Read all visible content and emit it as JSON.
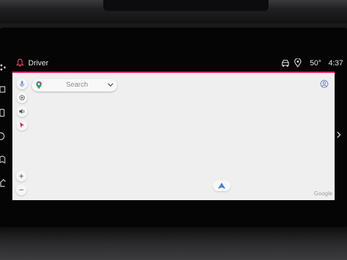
{
  "status_bar": {
    "profile_label": "Driver",
    "temperature": "50°",
    "time": "4:37"
  },
  "map": {
    "search_placeholder": "Search",
    "zoom_in_label": "+",
    "zoom_out_label": "−",
    "attribution": "Google"
  },
  "colors": {
    "accent": "#d8245a",
    "map_background": "#efefef",
    "nav_arrow": "#4a7fd4"
  }
}
